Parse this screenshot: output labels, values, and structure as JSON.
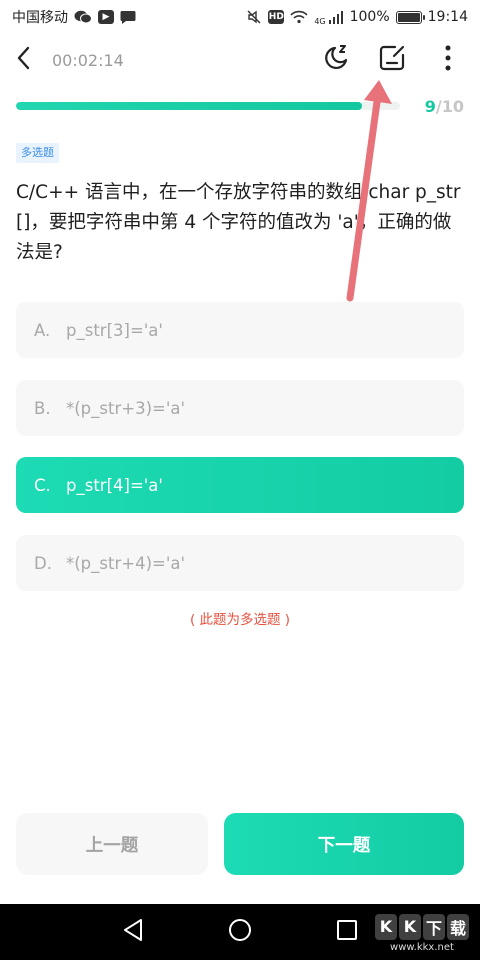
{
  "status_bar": {
    "carrier": "中国移动",
    "network": "4G",
    "battery": "100%",
    "time": "19:14",
    "hd_badge": "HD"
  },
  "header": {
    "timer": "00:02:14",
    "icons": [
      "back-arrow-icon",
      "night-mode-icon",
      "answer-sheet-icon",
      "more-vertical-icon"
    ]
  },
  "progress": {
    "current": "9",
    "separator": "/",
    "total": "10",
    "fraction": 0.9
  },
  "question": {
    "type_tag": "多选题",
    "text": "C/C++ 语言中，在一个存放字符串的数组 char p_str[]，要把字符串中第 4 个字符的值改为 'a'，正确的做法是?"
  },
  "options": [
    {
      "key": "A.",
      "text": "p_str[3]='a'",
      "selected": false
    },
    {
      "key": "B.",
      "text": "*(p_str+3)='a'",
      "selected": false
    },
    {
      "key": "C.",
      "text": "p_str[4]='a'",
      "selected": true
    },
    {
      "key": "D.",
      "text": "*(p_str+4)='a'",
      "selected": false
    }
  ],
  "hint": "( 此题为多选题 )",
  "buttons": {
    "prev": "上一题",
    "next": "下一题"
  },
  "watermark": {
    "logo": [
      "K",
      "K",
      "下",
      "载"
    ],
    "url": "www.kkx.net"
  },
  "colors": {
    "accent": "#14c7a0",
    "hint": "#e8523f",
    "tag_text": "#3a8ee6",
    "annotation_arrow": "#e8727a"
  }
}
